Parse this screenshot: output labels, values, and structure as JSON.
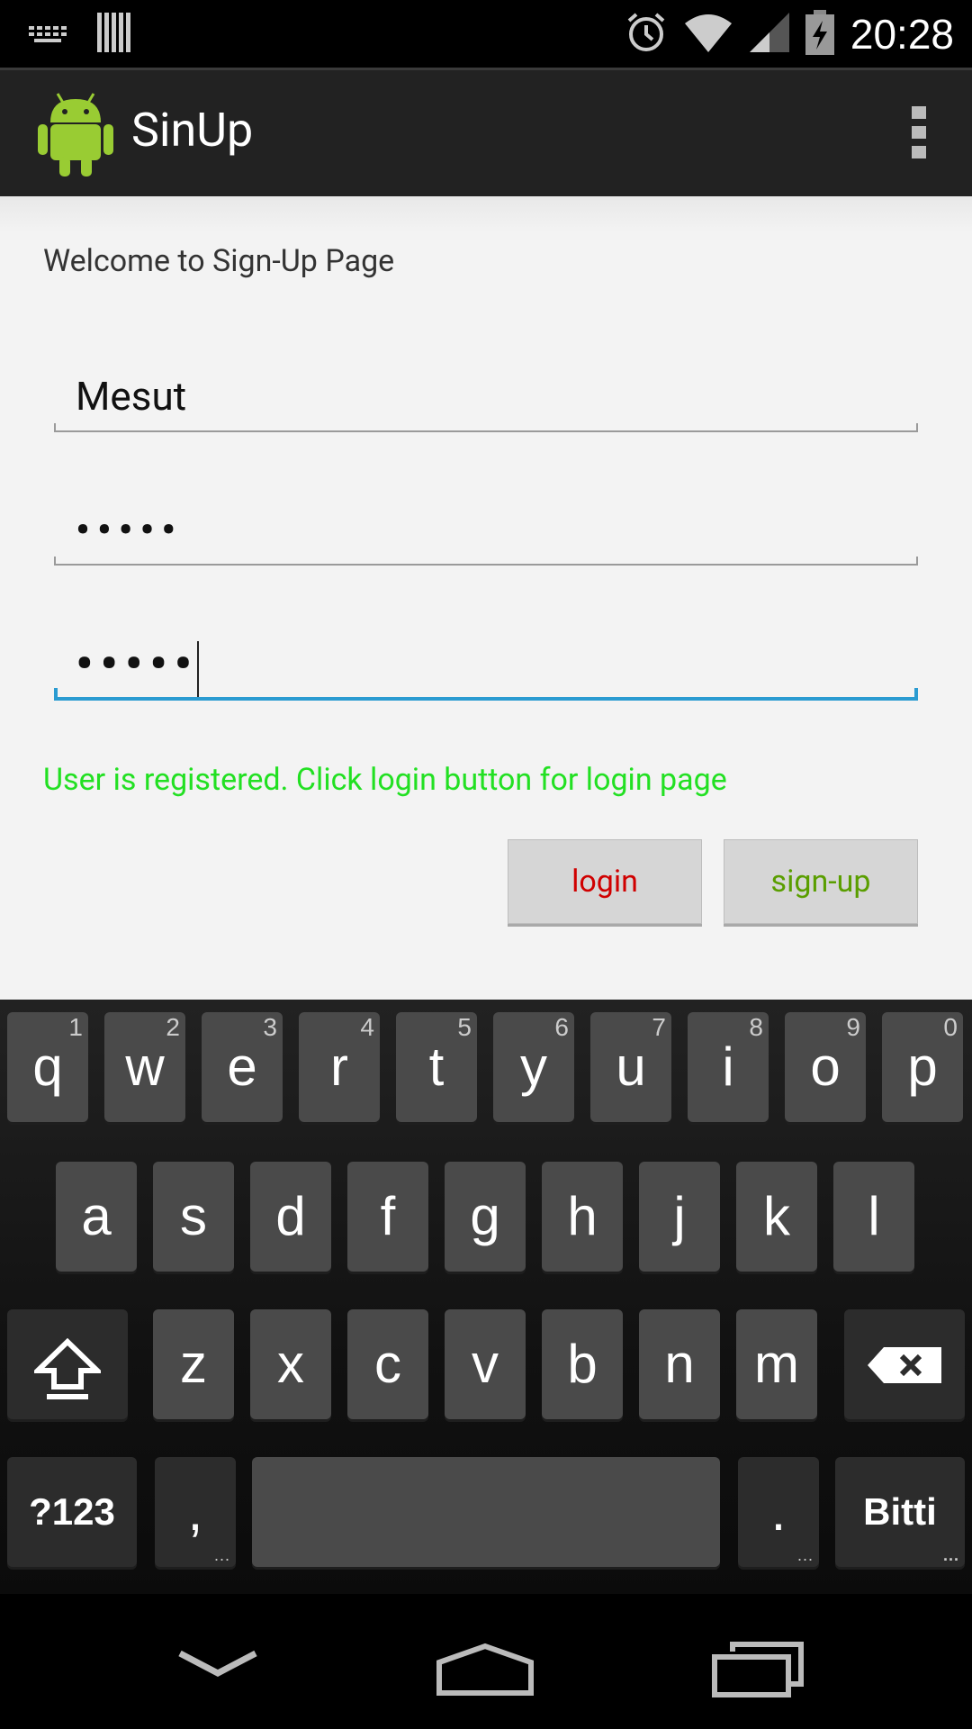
{
  "status_bar": {
    "time": "20:28",
    "icons": [
      "keyboard-icon",
      "barcode-icon",
      "alarm-icon",
      "wifi-icon",
      "signal-icon",
      "battery-charging-icon"
    ]
  },
  "action_bar": {
    "title": "SinUp",
    "app_icon": "android-icon",
    "overflow_icon": "overflow-menu-icon"
  },
  "form": {
    "welcome": "Welcome to Sign-Up Page",
    "username_value": "Mesut",
    "password_value": "•••••",
    "confirm_password_value": "•••••",
    "status_message": "User is registered. Click login button for login page",
    "status_color": "#22e022",
    "login_label": "login",
    "signup_label": "sign-up",
    "accent_color": "#2a9bd1"
  },
  "keyboard": {
    "row1": [
      {
        "key": "q",
        "hint": "1"
      },
      {
        "key": "w",
        "hint": "2"
      },
      {
        "key": "e",
        "hint": "3"
      },
      {
        "key": "r",
        "hint": "4"
      },
      {
        "key": "t",
        "hint": "5"
      },
      {
        "key": "y",
        "hint": "6"
      },
      {
        "key": "u",
        "hint": "7"
      },
      {
        "key": "i",
        "hint": "8"
      },
      {
        "key": "o",
        "hint": "9"
      },
      {
        "key": "p",
        "hint": "0"
      }
    ],
    "row2": [
      "a",
      "s",
      "d",
      "f",
      "g",
      "h",
      "j",
      "k",
      "l"
    ],
    "row3": [
      "z",
      "x",
      "c",
      "v",
      "b",
      "n",
      "m"
    ],
    "symbols_label": "?123",
    "comma_label": ",",
    "period_label": ".",
    "done_label": "Bitti"
  },
  "nav_bar": {
    "icons": [
      "back-icon",
      "home-icon",
      "recents-icon"
    ]
  }
}
